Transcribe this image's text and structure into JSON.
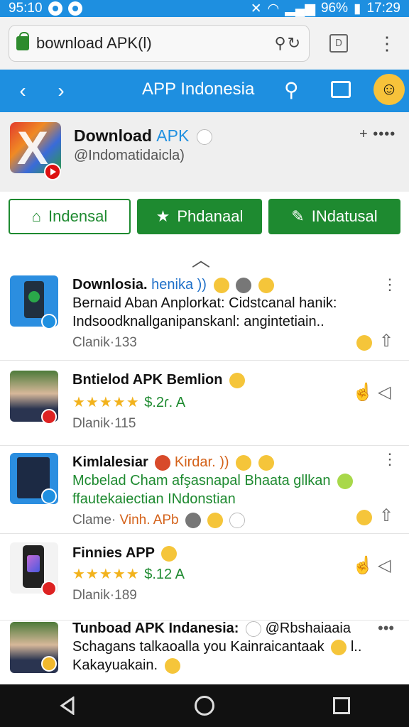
{
  "status_bar": {
    "time_left": "95:10",
    "battery": "96%",
    "time_right": "17:29"
  },
  "browser": {
    "url": "bownload APK(l)",
    "tab_count": "D"
  },
  "app_bar": {
    "title": "APP Indonesia"
  },
  "header": {
    "title": "Download",
    "title_accent": "APK",
    "subtitle": "@Indomatidaicla)",
    "actions": "+ ••••"
  },
  "tabs": [
    {
      "label": "Indensal"
    },
    {
      "label": "Phdanaal"
    },
    {
      "label": "INdatusal"
    }
  ],
  "items": [
    {
      "title": "Downlosia.",
      "tag": "henika ))",
      "line1": "Bernaid Aban Anplorkat: Cidstcanal hanik:",
      "line2": "Indsoodknallganipanskanl: angintetiain..",
      "meta": "Clanik·133"
    },
    {
      "title": "Bntielod APK Bemlion",
      "stars": "★★★★★",
      "price": "$.2ɾ. A",
      "meta": "Dlanik·115"
    },
    {
      "title": "Kimlalesiar",
      "tag": "Kirdar. ))",
      "line1": "Mcbelad Cham afşasnapal Bhaata gllkan",
      "line2": "ffautekaiectian INdonstian",
      "meta": "Clame·",
      "meta_accent": "Vinh. APb"
    },
    {
      "title": "Finnies APP",
      "stars": "★★★★★",
      "price": "$.12 A",
      "meta": "Dlanik·189"
    },
    {
      "title": "Tunboad APK Indanesia:",
      "tag": "@Rbshaiaaia",
      "line1": "Schagans talkaoalla you Kainraicantaak",
      "line1_end": "l..",
      "line2": "Kakayuakain."
    }
  ],
  "colors": {
    "primary_blue": "#1e8fe0",
    "green": "#1e8a30",
    "star_yellow": "#f2b21c",
    "accent_orange": "#d4621a"
  }
}
